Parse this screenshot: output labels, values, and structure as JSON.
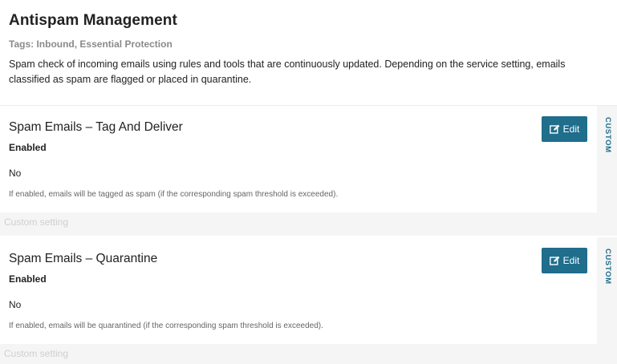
{
  "page": {
    "title": "Antispam Management",
    "tags": "Tags: Inbound, Essential Protection",
    "description": "Spam check of incoming emails using rules and tools that are continuously updated. Depending on the service setting, emails classified as spam are flagged or placed in quarantine."
  },
  "settings": [
    {
      "title": "Spam Emails – Tag And Deliver",
      "enabled_label": "Enabled",
      "value": "No",
      "help": "If enabled, emails will be tagged as spam (if the corresponding spam threshold is exceeded).",
      "edit_label": "Edit",
      "badge": "CUSTOM",
      "footer": "Custom setting"
    },
    {
      "title": "Spam Emails – Quarantine",
      "enabled_label": "Enabled",
      "value": "No",
      "help": "If enabled, emails will be quarantined (if the corresponding spam threshold is exceeded).",
      "edit_label": "Edit",
      "badge": "CUSTOM",
      "footer": "Custom setting"
    }
  ],
  "icons": {
    "edit": "edit-icon"
  },
  "colors": {
    "accent": "#1e6e8c",
    "panel_bg": "#f5f5f5"
  }
}
